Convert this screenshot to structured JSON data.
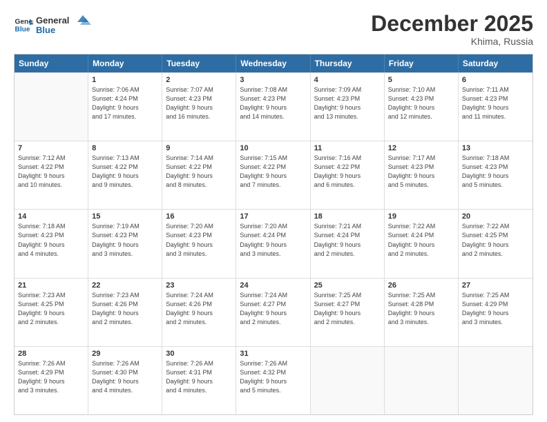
{
  "logo": {
    "line1": "General",
    "line2": "Blue"
  },
  "title": "December 2025",
  "location": "Khima, Russia",
  "days_of_week": [
    "Sunday",
    "Monday",
    "Tuesday",
    "Wednesday",
    "Thursday",
    "Friday",
    "Saturday"
  ],
  "weeks": [
    [
      {
        "day": "",
        "info": ""
      },
      {
        "day": "1",
        "info": "Sunrise: 7:06 AM\nSunset: 4:24 PM\nDaylight: 9 hours\nand 17 minutes."
      },
      {
        "day": "2",
        "info": "Sunrise: 7:07 AM\nSunset: 4:23 PM\nDaylight: 9 hours\nand 16 minutes."
      },
      {
        "day": "3",
        "info": "Sunrise: 7:08 AM\nSunset: 4:23 PM\nDaylight: 9 hours\nand 14 minutes."
      },
      {
        "day": "4",
        "info": "Sunrise: 7:09 AM\nSunset: 4:23 PM\nDaylight: 9 hours\nand 13 minutes."
      },
      {
        "day": "5",
        "info": "Sunrise: 7:10 AM\nSunset: 4:23 PM\nDaylight: 9 hours\nand 12 minutes."
      },
      {
        "day": "6",
        "info": "Sunrise: 7:11 AM\nSunset: 4:23 PM\nDaylight: 9 hours\nand 11 minutes."
      }
    ],
    [
      {
        "day": "7",
        "info": "Sunrise: 7:12 AM\nSunset: 4:22 PM\nDaylight: 9 hours\nand 10 minutes."
      },
      {
        "day": "8",
        "info": "Sunrise: 7:13 AM\nSunset: 4:22 PM\nDaylight: 9 hours\nand 9 minutes."
      },
      {
        "day": "9",
        "info": "Sunrise: 7:14 AM\nSunset: 4:22 PM\nDaylight: 9 hours\nand 8 minutes."
      },
      {
        "day": "10",
        "info": "Sunrise: 7:15 AM\nSunset: 4:22 PM\nDaylight: 9 hours\nand 7 minutes."
      },
      {
        "day": "11",
        "info": "Sunrise: 7:16 AM\nSunset: 4:22 PM\nDaylight: 9 hours\nand 6 minutes."
      },
      {
        "day": "12",
        "info": "Sunrise: 7:17 AM\nSunset: 4:23 PM\nDaylight: 9 hours\nand 5 minutes."
      },
      {
        "day": "13",
        "info": "Sunrise: 7:18 AM\nSunset: 4:23 PM\nDaylight: 9 hours\nand 5 minutes."
      }
    ],
    [
      {
        "day": "14",
        "info": "Sunrise: 7:18 AM\nSunset: 4:23 PM\nDaylight: 9 hours\nand 4 minutes."
      },
      {
        "day": "15",
        "info": "Sunrise: 7:19 AM\nSunset: 4:23 PM\nDaylight: 9 hours\nand 3 minutes."
      },
      {
        "day": "16",
        "info": "Sunrise: 7:20 AM\nSunset: 4:23 PM\nDaylight: 9 hours\nand 3 minutes."
      },
      {
        "day": "17",
        "info": "Sunrise: 7:20 AM\nSunset: 4:24 PM\nDaylight: 9 hours\nand 3 minutes."
      },
      {
        "day": "18",
        "info": "Sunrise: 7:21 AM\nSunset: 4:24 PM\nDaylight: 9 hours\nand 2 minutes."
      },
      {
        "day": "19",
        "info": "Sunrise: 7:22 AM\nSunset: 4:24 PM\nDaylight: 9 hours\nand 2 minutes."
      },
      {
        "day": "20",
        "info": "Sunrise: 7:22 AM\nSunset: 4:25 PM\nDaylight: 9 hours\nand 2 minutes."
      }
    ],
    [
      {
        "day": "21",
        "info": "Sunrise: 7:23 AM\nSunset: 4:25 PM\nDaylight: 9 hours\nand 2 minutes."
      },
      {
        "day": "22",
        "info": "Sunrise: 7:23 AM\nSunset: 4:26 PM\nDaylight: 9 hours\nand 2 minutes."
      },
      {
        "day": "23",
        "info": "Sunrise: 7:24 AM\nSunset: 4:26 PM\nDaylight: 9 hours\nand 2 minutes."
      },
      {
        "day": "24",
        "info": "Sunrise: 7:24 AM\nSunset: 4:27 PM\nDaylight: 9 hours\nand 2 minutes."
      },
      {
        "day": "25",
        "info": "Sunrise: 7:25 AM\nSunset: 4:27 PM\nDaylight: 9 hours\nand 2 minutes."
      },
      {
        "day": "26",
        "info": "Sunrise: 7:25 AM\nSunset: 4:28 PM\nDaylight: 9 hours\nand 3 minutes."
      },
      {
        "day": "27",
        "info": "Sunrise: 7:25 AM\nSunset: 4:29 PM\nDaylight: 9 hours\nand 3 minutes."
      }
    ],
    [
      {
        "day": "28",
        "info": "Sunrise: 7:26 AM\nSunset: 4:29 PM\nDaylight: 9 hours\nand 3 minutes."
      },
      {
        "day": "29",
        "info": "Sunrise: 7:26 AM\nSunset: 4:30 PM\nDaylight: 9 hours\nand 4 minutes."
      },
      {
        "day": "30",
        "info": "Sunrise: 7:26 AM\nSunset: 4:31 PM\nDaylight: 9 hours\nand 4 minutes."
      },
      {
        "day": "31",
        "info": "Sunrise: 7:26 AM\nSunset: 4:32 PM\nDaylight: 9 hours\nand 5 minutes."
      },
      {
        "day": "",
        "info": ""
      },
      {
        "day": "",
        "info": ""
      },
      {
        "day": "",
        "info": ""
      }
    ]
  ]
}
